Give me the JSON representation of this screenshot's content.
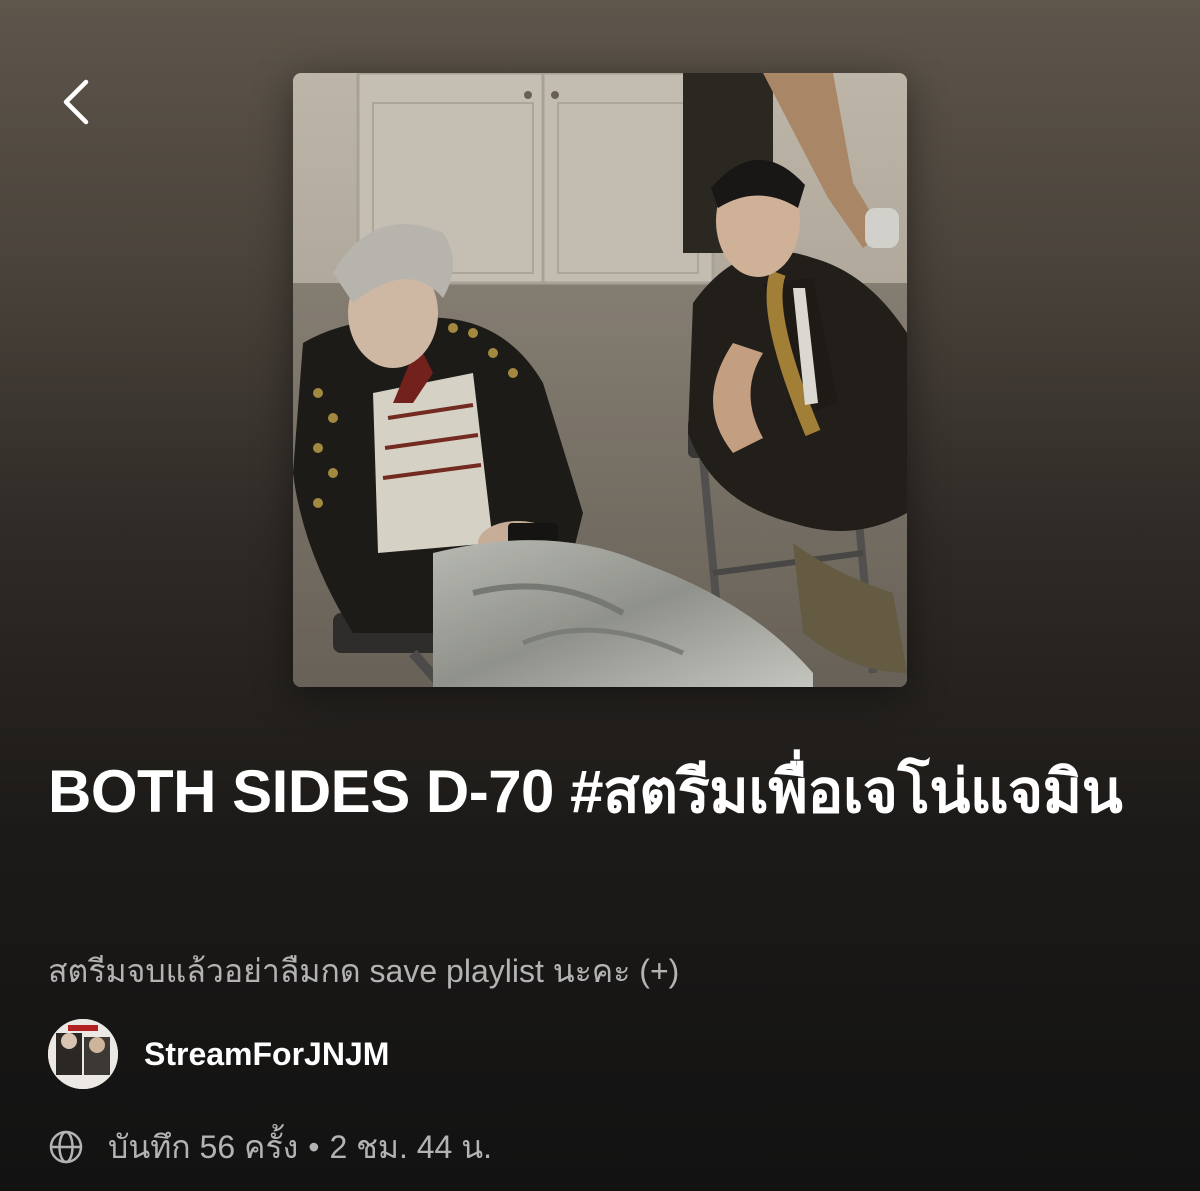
{
  "header": {
    "back_icon": "chevron-left-icon"
  },
  "playlist": {
    "cover_alt": "Playlist cover photo",
    "title": "BOTH SIDES D-70 #สตรีมเพื่อเจโน่แจมิน",
    "description": "สตรีมจบแล้วอย่าลืมกด save playlist นะคะ (+)",
    "owner": {
      "name": "StreamForJNJM",
      "avatar_icon": "avatar"
    },
    "meta": {
      "visibility_icon": "globe-icon",
      "saves": "บันทึก 56 ครั้ง",
      "separator": "•",
      "duration": "2 ชม. 44 น."
    }
  },
  "colors": {
    "background_top": "#5e564b",
    "background_bottom": "#121212",
    "text_primary": "#ffffff",
    "text_secondary": "#b3b3b3"
  }
}
